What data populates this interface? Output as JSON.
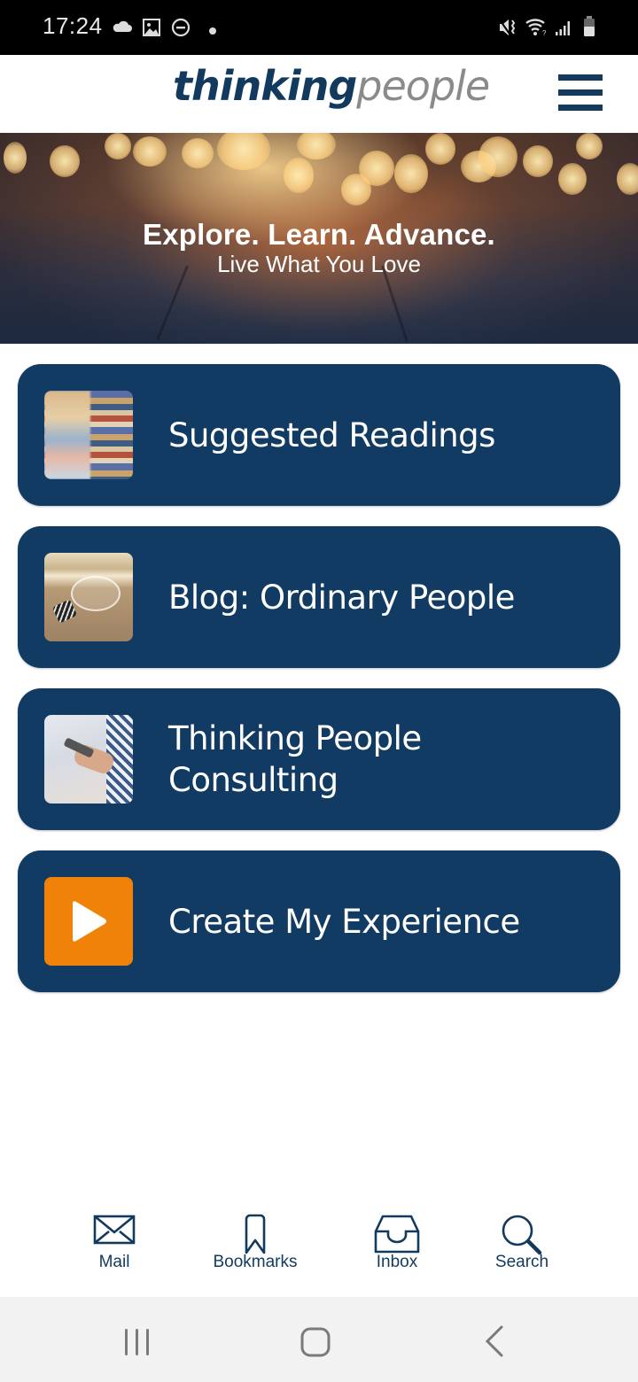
{
  "status_bar": {
    "time": "17:24",
    "left_icons": [
      "cloud-icon",
      "image-icon",
      "do-not-disturb-icon",
      "notification-dot-icon"
    ],
    "right_icons": [
      "mute-vibrate-icon",
      "wifi-icon",
      "signal-icon",
      "battery-icon"
    ]
  },
  "header": {
    "logo_part1": "thinking",
    "logo_part2": "people",
    "menu_icon": "hamburger-menu-icon"
  },
  "hero": {
    "title": "Explore. Learn. Advance.",
    "subtitle": "Live What You Love"
  },
  "cards": [
    {
      "label": "Suggested Readings",
      "thumbnail": "books-photo"
    },
    {
      "label": "Blog: Ordinary People",
      "thumbnail": "lightbulb-photo"
    },
    {
      "label": "Thinking People Consulting",
      "thumbnail": "phone-in-hand-photo"
    },
    {
      "label": "Create My Experience",
      "thumbnail": "play-icon"
    }
  ],
  "bottom_nav": [
    {
      "label": "Mail",
      "icon": "mail-icon"
    },
    {
      "label": "Bookmarks",
      "icon": "bookmark-icon"
    },
    {
      "label": "Inbox",
      "icon": "inbox-icon"
    },
    {
      "label": "Search",
      "icon": "search-icon"
    }
  ],
  "system_nav": [
    "recents-button",
    "home-button",
    "back-button"
  ],
  "colors": {
    "brand_navy": "#123b63",
    "logo_gray": "#8a8a8a",
    "play_orange": "#f0820a",
    "nav_text": "#123a5e"
  }
}
